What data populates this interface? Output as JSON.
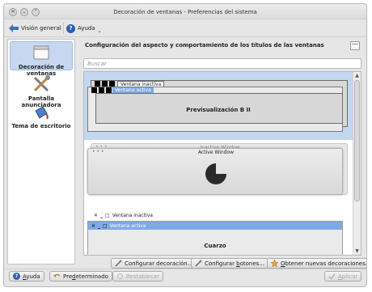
{
  "window": {
    "title": "Decoración de ventanas - Preferencias del sistema",
    "buttons": [
      "close-icon",
      "minimize-icon",
      "maximize-icon"
    ]
  },
  "toolbar": {
    "overview_label": "Visión general",
    "help_label": "Ayuda"
  },
  "sidebar": {
    "items": [
      {
        "label": "Decoración de ventanas",
        "icon": "window-decoration-icon",
        "selected": true
      },
      {
        "label": "Pantalla anunciadora",
        "icon": "tools-icon",
        "selected": false
      },
      {
        "label": "Tema de escritorio",
        "icon": "paint-bucket-icon",
        "selected": false
      }
    ]
  },
  "main": {
    "heading": "Configuración del aspecto y comportamiento de los títulos de las ventanas",
    "search_placeholder": "Buscar",
    "decorations": [
      {
        "name": "Previsualización B II",
        "inactive_title": "Ventana inactiva",
        "active_title": "Ventana activa",
        "selected": true
      },
      {
        "name": "",
        "inactive_title": "Inactive Window",
        "active_title": "Active Window",
        "selected": false
      },
      {
        "name": "Cuarzo",
        "inactive_title": "Ventana inactiva",
        "active_title": "Ventana activa",
        "selected": false
      }
    ],
    "buttons": {
      "configure_decoration": "Configurar decoración...",
      "configure_buttons_pre": "Configurar ",
      "configure_buttons_ul": "b",
      "configure_buttons_post": "otones...",
      "get_new_pre": "",
      "get_new_ul": "O",
      "get_new_post": "btener nuevas decoraciones..."
    }
  },
  "footer": {
    "help_ul": "A",
    "help_post": "yuda",
    "defaults_pre": "Pre",
    "defaults_ul": "d",
    "defaults_post": "eterminado",
    "reset_label": "Restablecer",
    "apply_ul": "A",
    "apply_post": "plicar"
  },
  "colors": {
    "selection": "#c3d7f1",
    "active_titlebar": "#7fa9e6",
    "help_blue": "#2a5fb0"
  }
}
